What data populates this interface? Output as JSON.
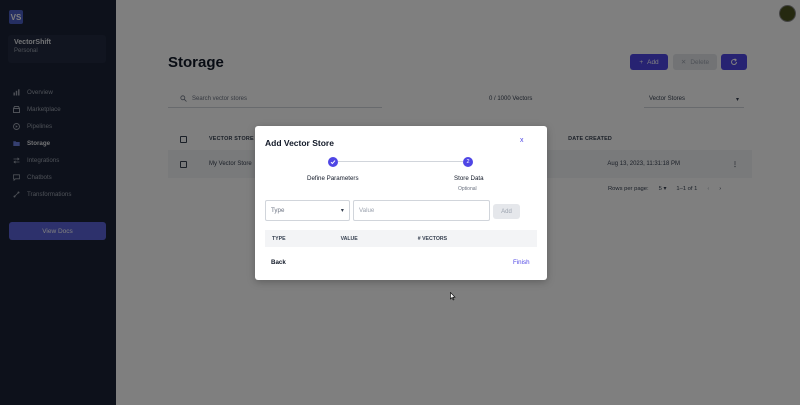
{
  "sidebar": {
    "logo": "VS",
    "org_name": "VectorShift",
    "org_sub": "Personal",
    "items": [
      {
        "label": "Overview",
        "icon": "chart-icon"
      },
      {
        "label": "Marketplace",
        "icon": "store-icon"
      },
      {
        "label": "Pipelines",
        "icon": "play-icon"
      },
      {
        "label": "Storage",
        "icon": "folder-icon",
        "active": true
      },
      {
        "label": "Integrations",
        "icon": "swap-icon"
      },
      {
        "label": "Chatbots",
        "icon": "chat-icon"
      },
      {
        "label": "Transformations",
        "icon": "transform-icon"
      }
    ],
    "docs_label": "View Docs"
  },
  "header": {
    "title": "Storage",
    "add_label": "Add",
    "delete_label": "Delete"
  },
  "toolbar": {
    "search_placeholder": "Search vector stores",
    "vector_count": "0 / 1000 Vectors",
    "filter_value": "Vector Stores"
  },
  "table": {
    "columns": [
      "VECTOR STORE NA",
      "DATE CREATED"
    ],
    "rows": [
      {
        "name": "My Vector Store",
        "date": "Aug 13, 2023, 11:31:18 PM"
      }
    ],
    "rows_per_page_label": "Rows per page:",
    "rows_per_page": "5",
    "range": "1–1 of 1"
  },
  "modal": {
    "title": "Add Vector Store",
    "close": "x",
    "steps": [
      {
        "label": "Define Parameters",
        "sub": "",
        "index": "1",
        "completed": true
      },
      {
        "label": "Store Data",
        "sub": "Optional",
        "index": "2",
        "completed": false
      }
    ],
    "type_placeholder": "Type",
    "value_placeholder": "Value",
    "add_label": "Add",
    "columns": [
      "TYPE",
      "VALUE",
      "# VECTORS"
    ],
    "back_label": "Back",
    "finish_label": "Finish"
  },
  "colors": {
    "accent": "#4f46e5",
    "sidebar_bg": "#1a2236"
  }
}
